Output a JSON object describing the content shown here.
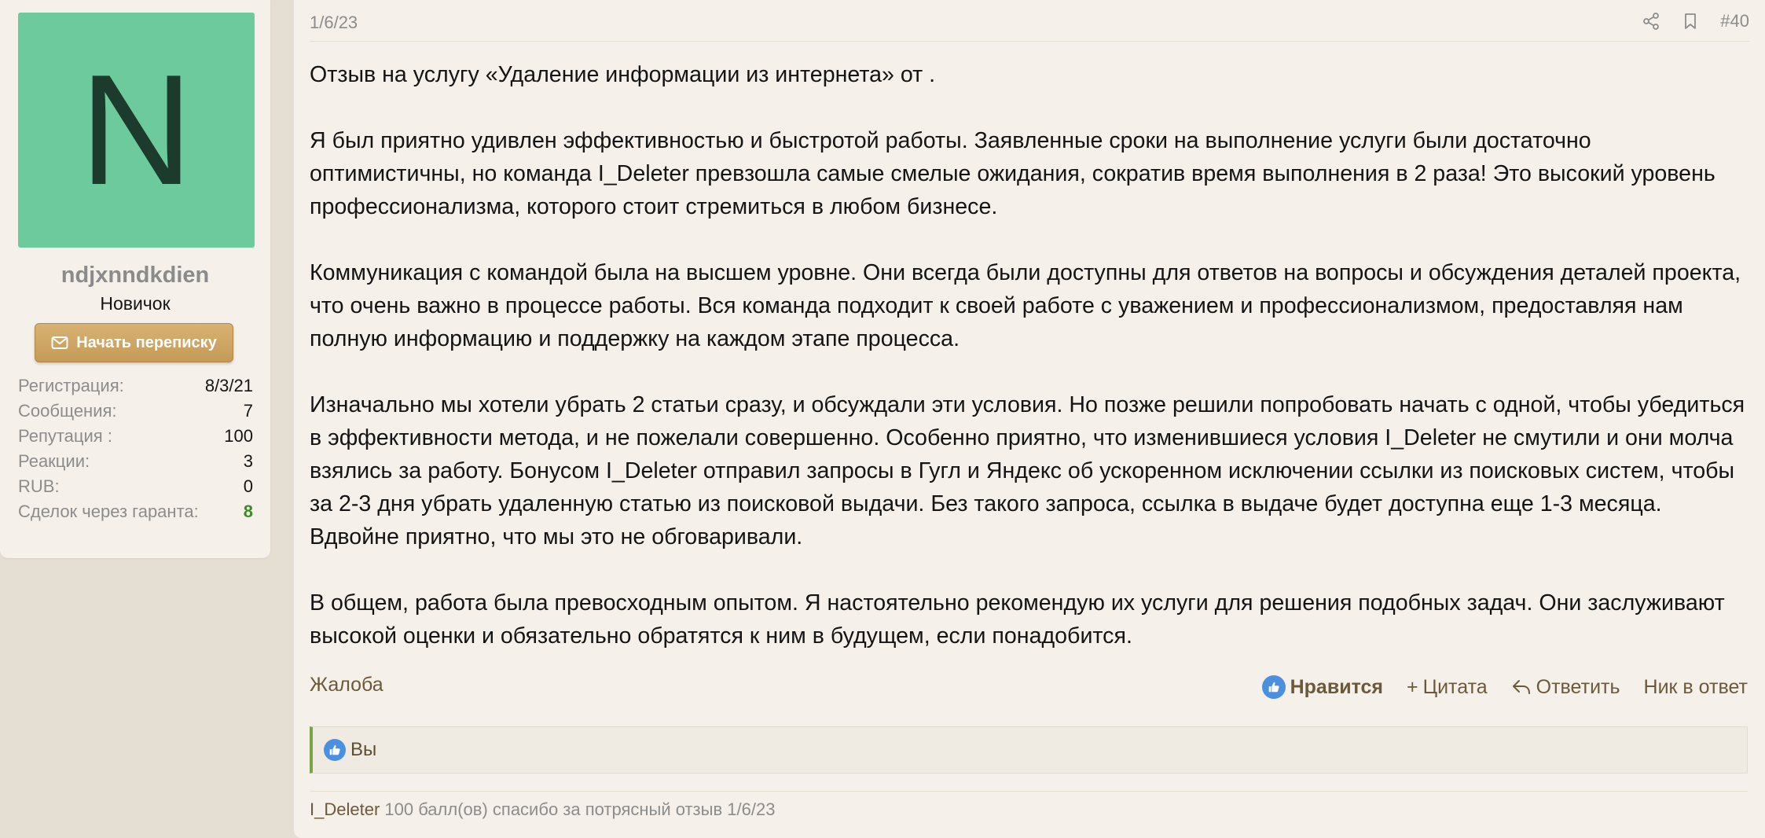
{
  "user": {
    "avatar_letter": "N",
    "avatar_color": "#6dca9c",
    "username": "ndjxnndkdien",
    "title": "Новичок",
    "message_button": "Начать переписку",
    "stats": [
      {
        "label": "Регистрация:",
        "value": "8/3/21"
      },
      {
        "label": "Сообщения:",
        "value": "7"
      },
      {
        "label": "Репутация :",
        "value": "100"
      },
      {
        "label": "Реакции:",
        "value": "3"
      },
      {
        "label": "RUB:",
        "value": "0"
      },
      {
        "label": "Сделок через гаранта:",
        "value": "8"
      }
    ]
  },
  "post": {
    "date": "1/6/23",
    "number": "#40",
    "paragraphs": [
      "Отзыв на услугу «Удаление информации из интернета» от .",
      "Я был приятно удивлен эффективностью и быстротой работы. Заявленные сроки на выполнение услуги были достаточно оптимистичны, но команда I_Deleter превзошла самые смелые ожидания, сократив время выполнения в 2 раза! Это высокий уровень профессионализма, которого стоит стремиться в любом бизнесе.",
      "Коммуникация с командой была на высшем уровне. Они всегда были доступны для ответов на вопросы и обсуждения деталей проекта, что очень важно в процессе работы. Вся команда подходит к своей работе с уважением и профессионализмом, предоставляя нам полную информацию и поддержку на каждом этапе процесса.",
      "Изначально мы хотели убрать 2 статьи сразу, и обсуждали эти условия. Но позже решили попробовать начать с одной, чтобы убедиться в эффективности метода, и не пожелали совершенно. Особенно приятно, что изменившиеся условия I_Deleter не смутили и они молча взялись за работу. Бонусом I_Deleter отправил запросы в Гугл и Яндекс об ускоренном исключении ссылки из поисковых систем, чтобы за 2-3 дня убрать удаленную статью из поисковой выдачи. Без такого запроса, ссылка в выдаче будет доступна еще 1-3 месяца. Вдвойне приятно, что мы это не обговаривали.",
      "В общем, работа была превосходным опытом. Я настоятельно рекомендую их услуги для решения подобных задач. Они заслуживают высокой оценки и обязательно обратятся к ним в будущем, если понадобится."
    ],
    "actions": {
      "report": "Жалоба",
      "like": "Нравится",
      "quote": "Цитата",
      "reply": "Ответить",
      "nick": "Ник в ответ"
    },
    "reactions_text": "Вы",
    "reward": {
      "user": "I_Deleter",
      "text": " 100 балл(ов) спасибо за потрясный отзыв 1/6/23"
    }
  },
  "colors": {
    "page_bg": "#e4ded3",
    "panel_bg": "#f5f1ea",
    "button_gold": "#c59a57",
    "link_brown": "#6b5a3a",
    "like_blue": "#4a8fe0",
    "accent_green": "#7aa547",
    "deal_count_green": "#3a8a26"
  },
  "icons": [
    "envelope-icon",
    "share-icon",
    "bookmark-icon",
    "like-icon",
    "plus-icon",
    "reply-icon"
  ]
}
